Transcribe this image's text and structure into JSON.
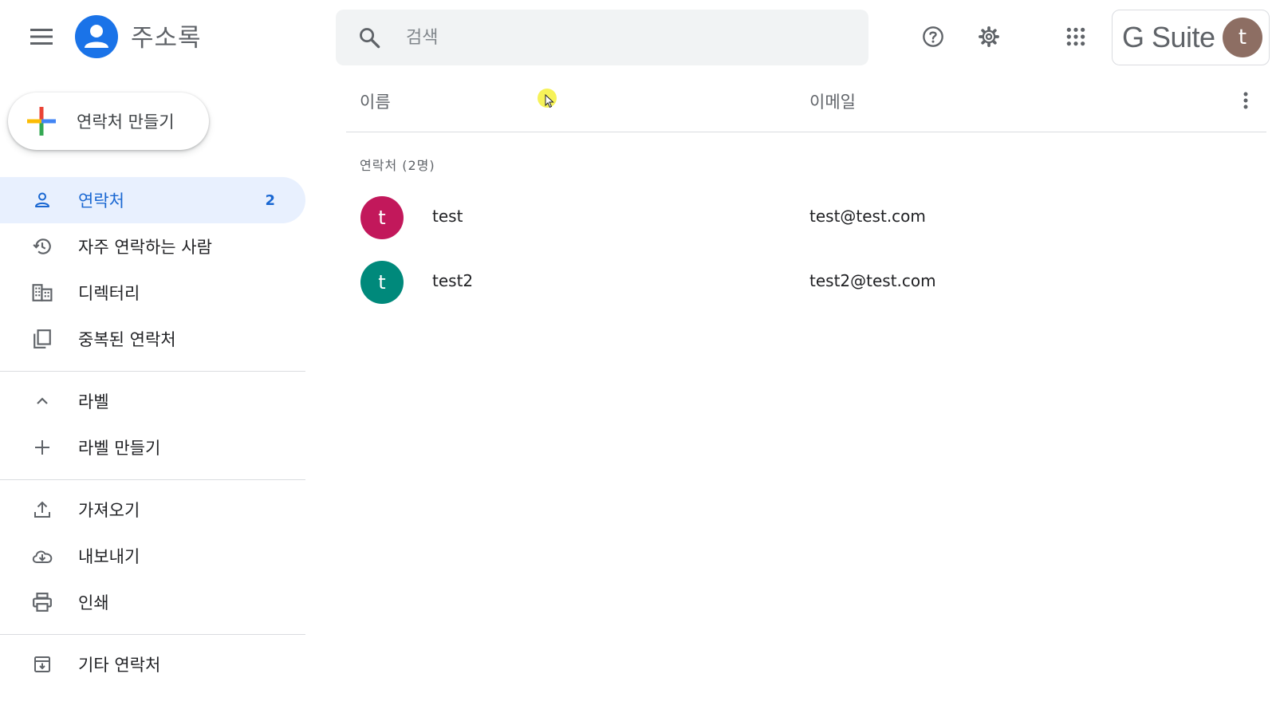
{
  "header": {
    "app_title": "주소록",
    "search_placeholder": "검색",
    "brand": "G Suite",
    "account_initial": "t",
    "colors": {
      "app_logo": "#1a73e8",
      "account_avatar": "#8d6e63"
    }
  },
  "sidebar": {
    "create_label": "연락처 만들기",
    "items": [
      {
        "label": "연락처",
        "count": "2",
        "icon": "person-icon",
        "active": true
      },
      {
        "label": "자주 연락하는 사람",
        "icon": "history-icon"
      },
      {
        "label": "디렉터리",
        "icon": "domain-icon"
      },
      {
        "label": "중복된 연락처",
        "icon": "copy-icon"
      }
    ],
    "labels_section": {
      "toggle_label": "라벨",
      "create_label": "라벨 만들기"
    },
    "actions": [
      {
        "label": "가져오기",
        "icon": "upload-icon"
      },
      {
        "label": "내보내기",
        "icon": "cloud-download-icon"
      },
      {
        "label": "인쇄",
        "icon": "print-icon"
      }
    ],
    "other_contacts": {
      "label": "기타 연락처",
      "icon": "archive-icon"
    }
  },
  "list": {
    "columns": {
      "name": "이름",
      "email": "이메일"
    },
    "section_label": "연락처 (2명)",
    "contacts": [
      {
        "initial": "t",
        "name": "test",
        "email": "test@test.com",
        "color": "#c2185b"
      },
      {
        "initial": "t",
        "name": "test2",
        "email": "test2@test.com",
        "color": "#00897b"
      }
    ]
  }
}
